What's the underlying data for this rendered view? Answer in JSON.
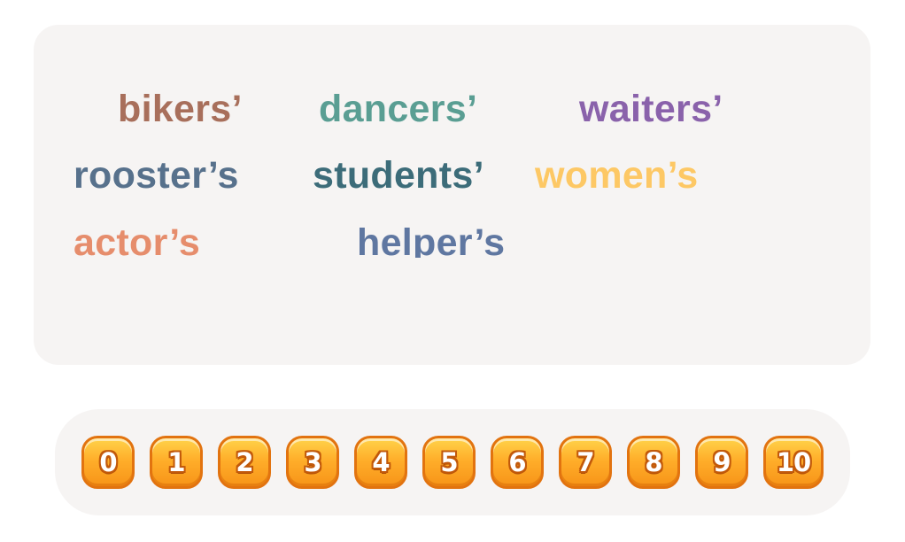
{
  "words": [
    {
      "id": "bikers",
      "text": "bikers’",
      "color": "#a86f5b"
    },
    {
      "id": "dancers",
      "text": "dancers’",
      "color": "#5a9e93"
    },
    {
      "id": "waiters",
      "text": "waiters’",
      "color": "#8a62ab"
    },
    {
      "id": "roosters",
      "text": "rooster’s",
      "color": "#57718c"
    },
    {
      "id": "students",
      "text": "students’",
      "color": "#3c6c79"
    },
    {
      "id": "womens",
      "text": "women’s",
      "color": "#fdc865"
    },
    {
      "id": "actors",
      "text": "actor’s",
      "color": "#e68d6c"
    },
    {
      "id": "helpers",
      "text": "helper’s",
      "color": "#5f77a1"
    }
  ],
  "number_bar": {
    "buttons": [
      "0",
      "1",
      "2",
      "3",
      "4",
      "5",
      "6",
      "7",
      "8",
      "9",
      "10"
    ],
    "button_color": "#ffae2a",
    "border_color": "#e2730f"
  }
}
